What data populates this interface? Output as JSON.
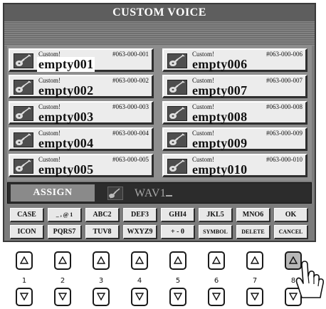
{
  "title": "CUSTOM VOICE",
  "voices": [
    {
      "category": "Custom!",
      "number": "#063-000-001",
      "name": "empty001",
      "selected": true
    },
    {
      "category": "Custom!",
      "number": "#063-000-002",
      "name": "empty002"
    },
    {
      "category": "Custom!",
      "number": "#063-000-003",
      "name": "empty003"
    },
    {
      "category": "Custom!",
      "number": "#063-000-004",
      "name": "empty004"
    },
    {
      "category": "Custom!",
      "number": "#063-000-005",
      "name": "empty005"
    },
    {
      "category": "Custom!",
      "number": "#063-000-006",
      "name": "empty006"
    },
    {
      "category": "Custom!",
      "number": "#063-000-007",
      "name": "empty007"
    },
    {
      "category": "Custom!",
      "number": "#063-000-008",
      "name": "empty008"
    },
    {
      "category": "Custom!",
      "number": "#063-000-009",
      "name": "empty009"
    },
    {
      "category": "Custom!",
      "number": "#063-000-010",
      "name": "empty010"
    }
  ],
  "assign": {
    "label": "ASSIGN",
    "value": "WAV1",
    "icon": "guitar-icon"
  },
  "keyboard": {
    "row1": [
      "CASE",
      "_ , @ 1",
      "ABC2",
      "DEF3",
      "GHI4",
      "JKL5",
      "MNO6",
      "OK"
    ],
    "row2": [
      "ICON",
      "PQRS7",
      "TUV8",
      "WXYZ9",
      "+ - 0",
      "SYMBOL",
      "DELETE",
      "CANCEL"
    ]
  },
  "panel_buttons": {
    "numbers": [
      "1",
      "2",
      "3",
      "4",
      "5",
      "6",
      "7",
      "8"
    ],
    "up_icon": "triangle-up-icon",
    "down_icon": "triangle-down-icon"
  },
  "pointer_icon": "hand-pointer-icon"
}
